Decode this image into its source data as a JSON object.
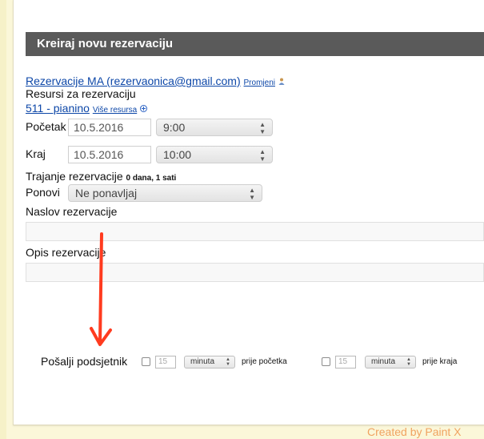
{
  "header": {
    "title": "Kreiraj novu rezervaciju"
  },
  "owner": {
    "link": "Rezervacije MA (rezervaonica@gmail.com)",
    "change_label": "Promjeni"
  },
  "resources": {
    "label": "Resursi za rezervaciju",
    "item": "511 - pianino",
    "more_label": "Više resursa"
  },
  "start": {
    "label": "Početak",
    "date": "10.5.2016",
    "time": "9:00"
  },
  "end": {
    "label": "Kraj",
    "date": "10.5.2016",
    "time": "10:00"
  },
  "duration": {
    "label": "Trajanje rezervacije",
    "value": "0 dana, 1 sati"
  },
  "repeat": {
    "label": "Ponovi",
    "value": "Ne ponavljaj"
  },
  "title_field": {
    "label": "Naslov rezervacije"
  },
  "description_field": {
    "label": "Opis rezervacije"
  },
  "reminder": {
    "label": "Pošalji podsjetnik",
    "before_start": {
      "amount": "15",
      "unit": "minuta",
      "suffix": "prije početka"
    },
    "before_end": {
      "amount": "15",
      "unit": "minuta",
      "suffix": "prije kraja"
    }
  },
  "watermark": "Created by Paint X",
  "colors": {
    "header_bg": "#5a5a5a",
    "link": "#0d47a8",
    "annotation_arrow": "#ff3b1f",
    "background": "#fbf7d9"
  }
}
